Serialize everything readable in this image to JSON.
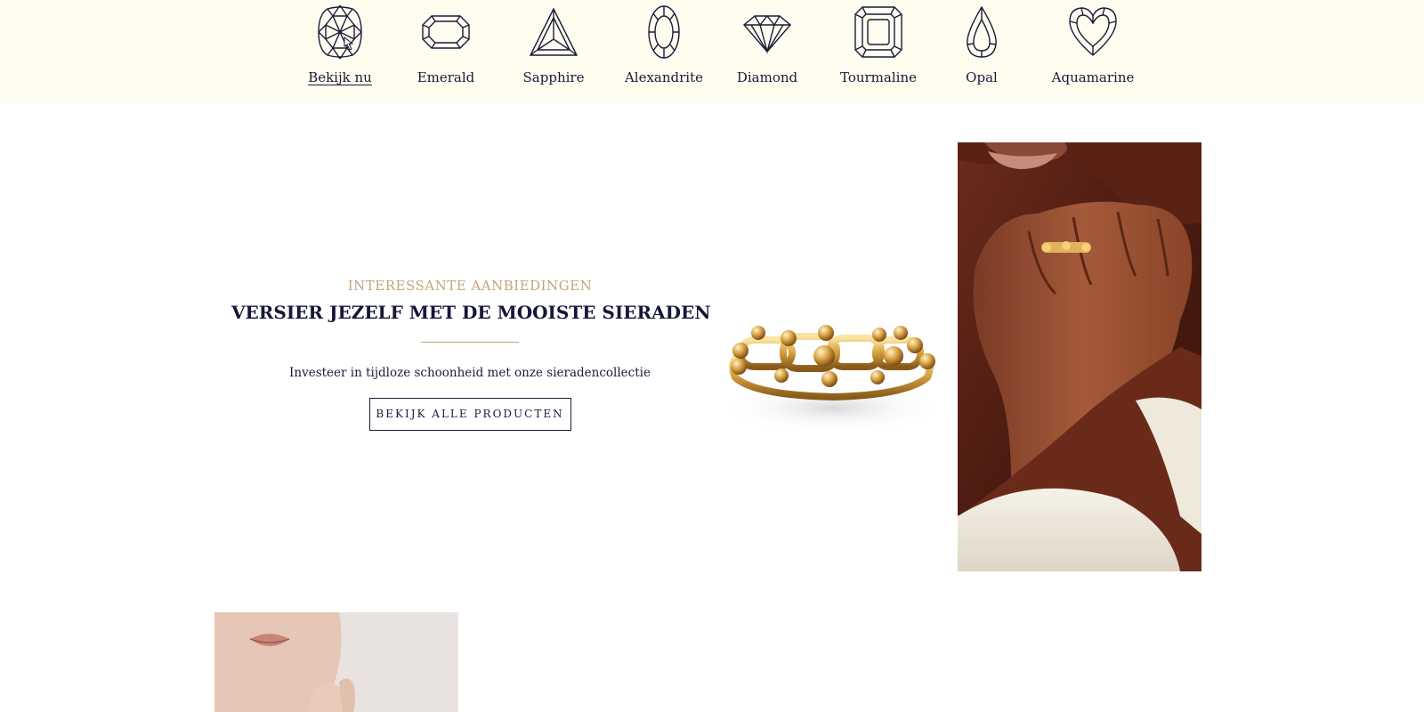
{
  "categories": [
    {
      "label": "Bekijk nu",
      "icon": "cushion-gem-icon",
      "active": true
    },
    {
      "label": "Emerald",
      "icon": "emerald-cut-icon",
      "active": false
    },
    {
      "label": "Sapphire",
      "icon": "trillion-cut-icon",
      "active": false
    },
    {
      "label": "Alexandrite",
      "icon": "oval-cut-icon",
      "active": false
    },
    {
      "label": "Diamond",
      "icon": "brilliant-diamond-icon",
      "active": false
    },
    {
      "label": "Tourmaline",
      "icon": "asscher-cut-icon",
      "active": false
    },
    {
      "label": "Opal",
      "icon": "pear-cut-icon",
      "active": false
    },
    {
      "label": "Aquamarine",
      "icon": "heart-cut-icon",
      "active": false
    }
  ],
  "hero": {
    "eyebrow": "INTERESSANTE AANBIEDINGEN",
    "headline": "VERSIER JEZELF MET DE MOOISTE SIERADEN",
    "subtext": "Investeer in tijdloze schoonheid met onze sieradencollectie",
    "cta_label": "BEKIJK ALLE PRODUCTEN"
  },
  "images": {
    "ring": "gold-link-ring-image",
    "hand": "hand-wearing-ring-photo",
    "teaser": "model-portrait-photo"
  },
  "colors": {
    "strip_bg": "#fefdf0",
    "gold_accent": "#c4a47c",
    "navy_text": "#16163a"
  }
}
